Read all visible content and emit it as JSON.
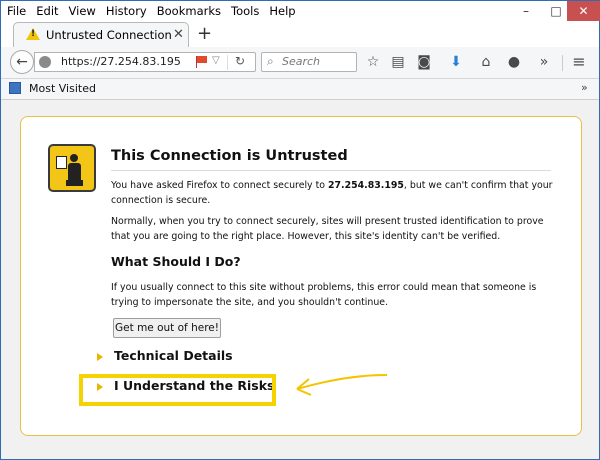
{
  "menu": [
    "File",
    "Edit",
    "View",
    "History",
    "Bookmarks",
    "Tools",
    "Help"
  ],
  "window_controls": {
    "minimize": "–",
    "maximize": "□",
    "close": "✕"
  },
  "tab": {
    "title": "Untrusted Connection",
    "close": "✕",
    "new_tab": "+",
    "warn_mark": "!"
  },
  "toolbar": {
    "back": "←",
    "url": "https://27.254.83.195",
    "url_dropdown": "▽",
    "reload": "↻",
    "search_placeholder": "Search",
    "overflow": "»",
    "menu": "≡",
    "icons": [
      "star-icon",
      "reading-list-icon",
      "pocket-icon",
      "download-icon",
      "home-icon",
      "hello-icon",
      "overflow-icon",
      "menu-icon"
    ]
  },
  "bookmarks": {
    "label": "Most Visited",
    "chevron": "»"
  },
  "error": {
    "title": "This Connection is Untrusted",
    "p1_pre": "You have asked Firefox to connect securely to ",
    "p1_host": "27.254.83.195",
    "p1_post": ", but we can't confirm that your connection is secure.",
    "p2": "Normally, when you try to connect securely, sites will present trusted identification to prove that you are going to the right place. However, this site's identity can't be verified.",
    "h2": "What Should I Do?",
    "p3": "If you usually connect to this site without problems, this error could mean that someone is trying to impersonate the site, and you shouldn't continue.",
    "button": "Get me out of here!",
    "technical": "Technical Details",
    "risks": "I Understand the Risks"
  },
  "colors": {
    "highlight": "#f4d300",
    "border": "#e9c04a",
    "accent": "#3b75c0"
  }
}
